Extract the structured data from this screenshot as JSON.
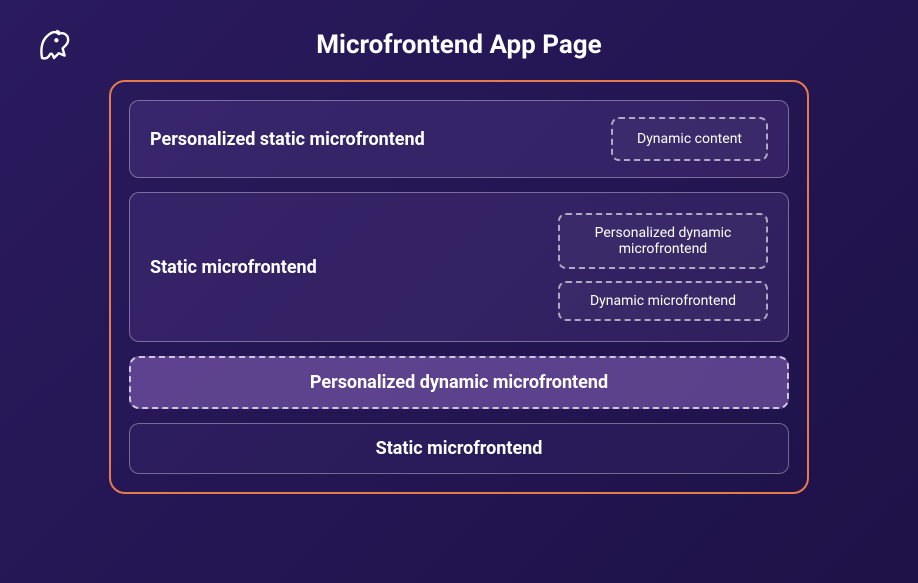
{
  "title": "Microfrontend App Page",
  "rows": {
    "row1": {
      "label": "Personalized static microfrontend",
      "sub": "Dynamic content"
    },
    "row2": {
      "label": "Static microfrontend",
      "sub1": "Personalized dynamic microfrontend",
      "sub2": "Dynamic microfrontend"
    },
    "row3": {
      "label": "Personalized dynamic microfrontend"
    },
    "row4": {
      "label": "Static microfrontend"
    }
  }
}
